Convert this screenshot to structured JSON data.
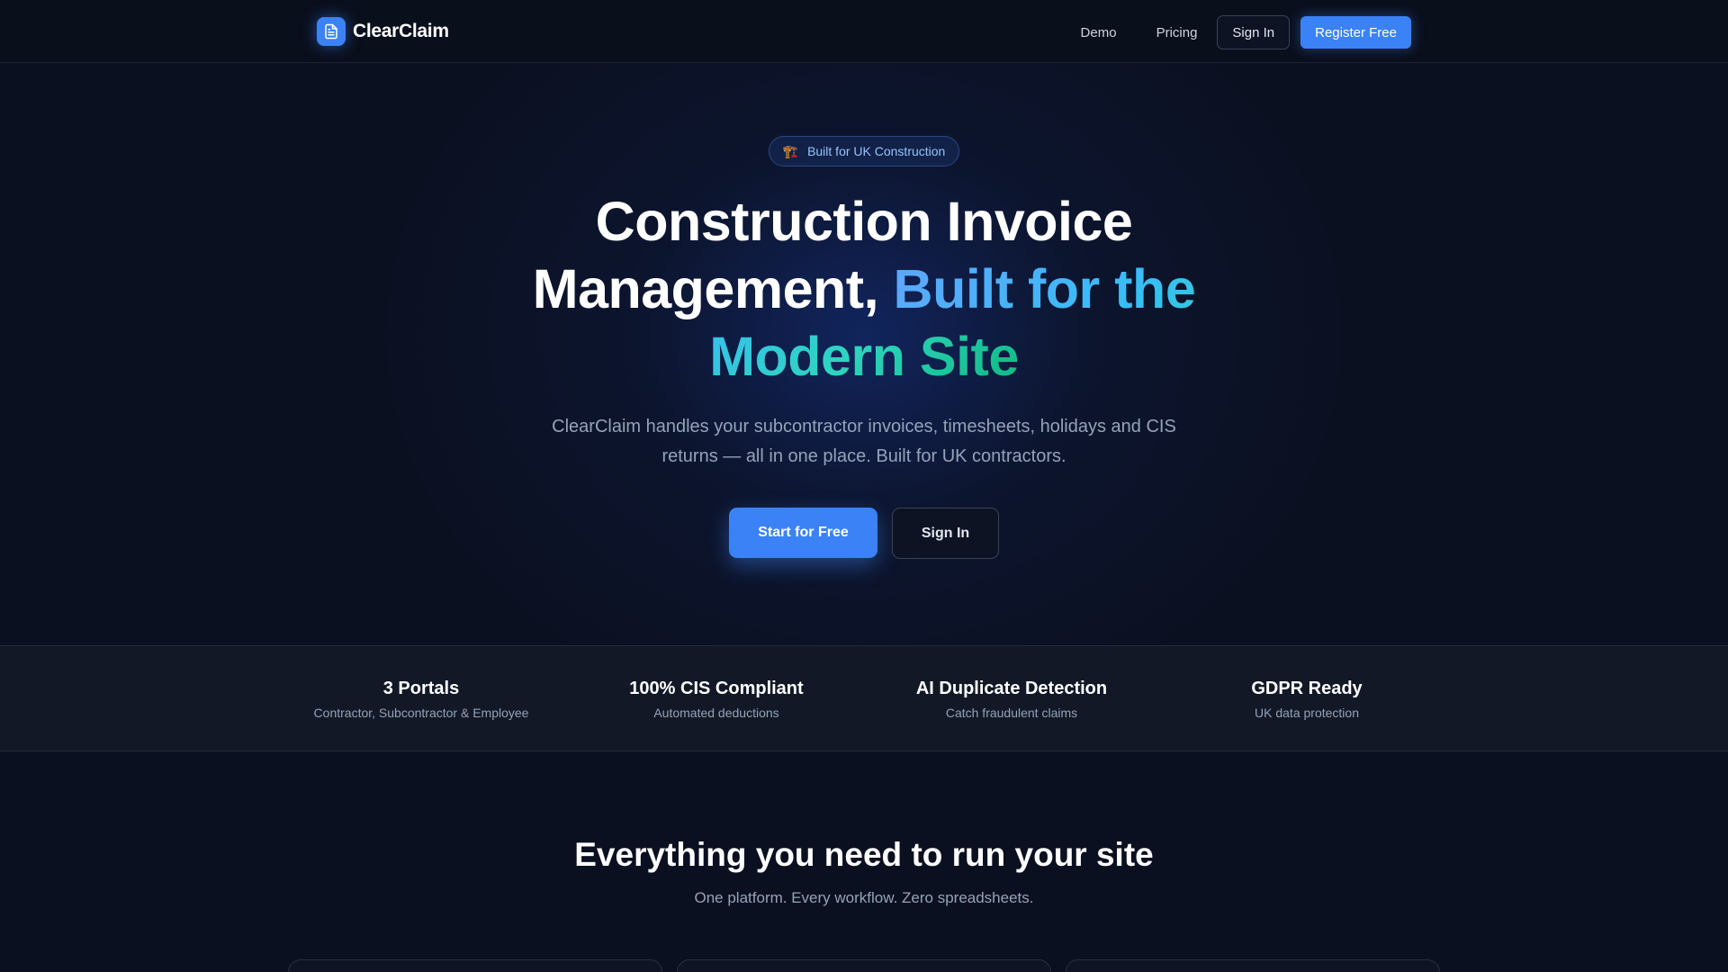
{
  "header": {
    "brand_name": "ClearClaim",
    "brand_icon": "document-icon",
    "nav": {
      "demo": "Demo",
      "pricing": "Pricing",
      "sign_in": "Sign In",
      "register": "Register Free"
    }
  },
  "hero": {
    "badge_icon": "🏗️",
    "badge_text": "Built for UK Construction",
    "headline_plain": "Construction Invoice Management,",
    "headline_gradient": "Built for the Modern Site",
    "subtitle": "ClearClaim handles your subcontractor invoices, timesheets, holidays and CIS returns — all in one place. Built for UK contractors.",
    "cta_primary": "Start for Free",
    "cta_secondary": "Sign In"
  },
  "stats": [
    {
      "title": "3 Portals",
      "desc": "Contractor, Subcontractor & Employee"
    },
    {
      "title": "100% CIS Compliant",
      "desc": "Automated deductions"
    },
    {
      "title": "AI Duplicate Detection",
      "desc": "Catch fraudulent claims"
    },
    {
      "title": "GDPR Ready",
      "desc": "UK data protection"
    }
  ],
  "features": {
    "title": "Everything you need to run your site",
    "subtitle": "One platform. Every workflow. Zero spreadsheets."
  },
  "colors": {
    "background": "#0b1020",
    "accent": "#3b82f6",
    "gradient_start": "#60a5fa",
    "gradient_end": "#10b981"
  }
}
